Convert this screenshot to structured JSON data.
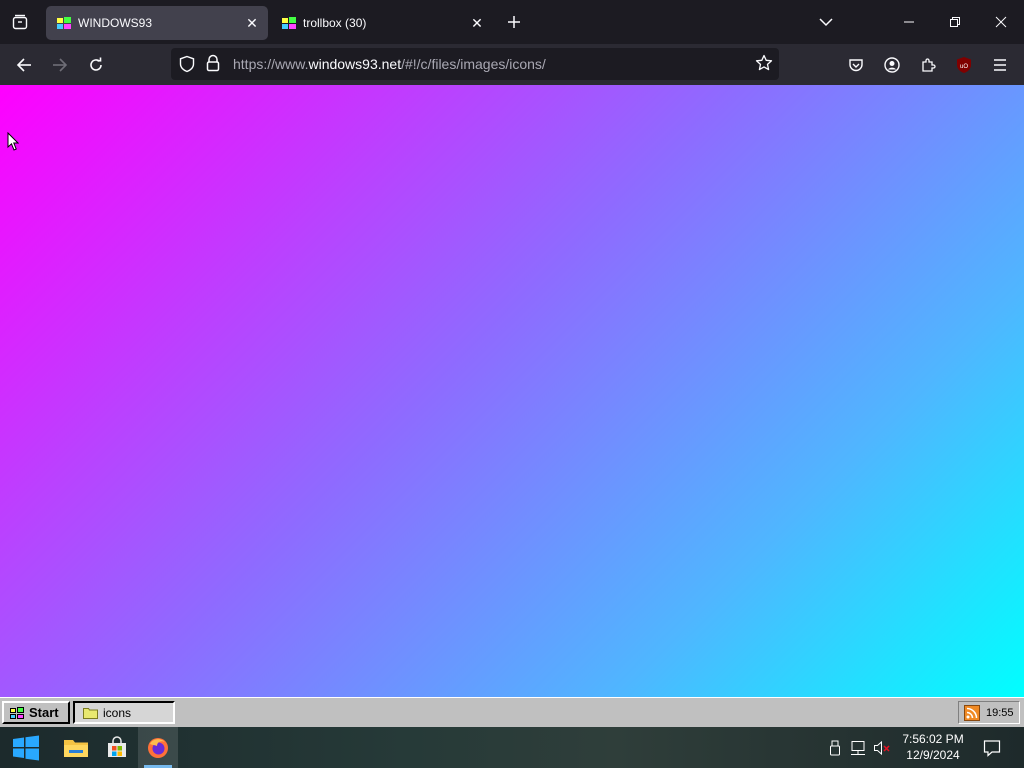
{
  "browser": {
    "tabs": [
      {
        "title": "WINDOWS93",
        "active": true
      },
      {
        "title": "trollbox (30)",
        "active": false
      }
    ],
    "url": {
      "prefix": "https://www.",
      "host": "windows93.net",
      "path": "/#!/c/files/images/icons/"
    }
  },
  "w93_taskbar": {
    "start_label": "Start",
    "task_label": "icons",
    "clock": "19:55"
  },
  "windows_taskbar": {
    "time": "7:56:02 PM",
    "date": "12/9/2024"
  },
  "colors": {
    "gradient_top_left": "#ff00ff",
    "gradient_bottom_right": "#00ffff",
    "browser_chrome": "#1c1b22",
    "w93_gray": "#c0c0c0"
  }
}
